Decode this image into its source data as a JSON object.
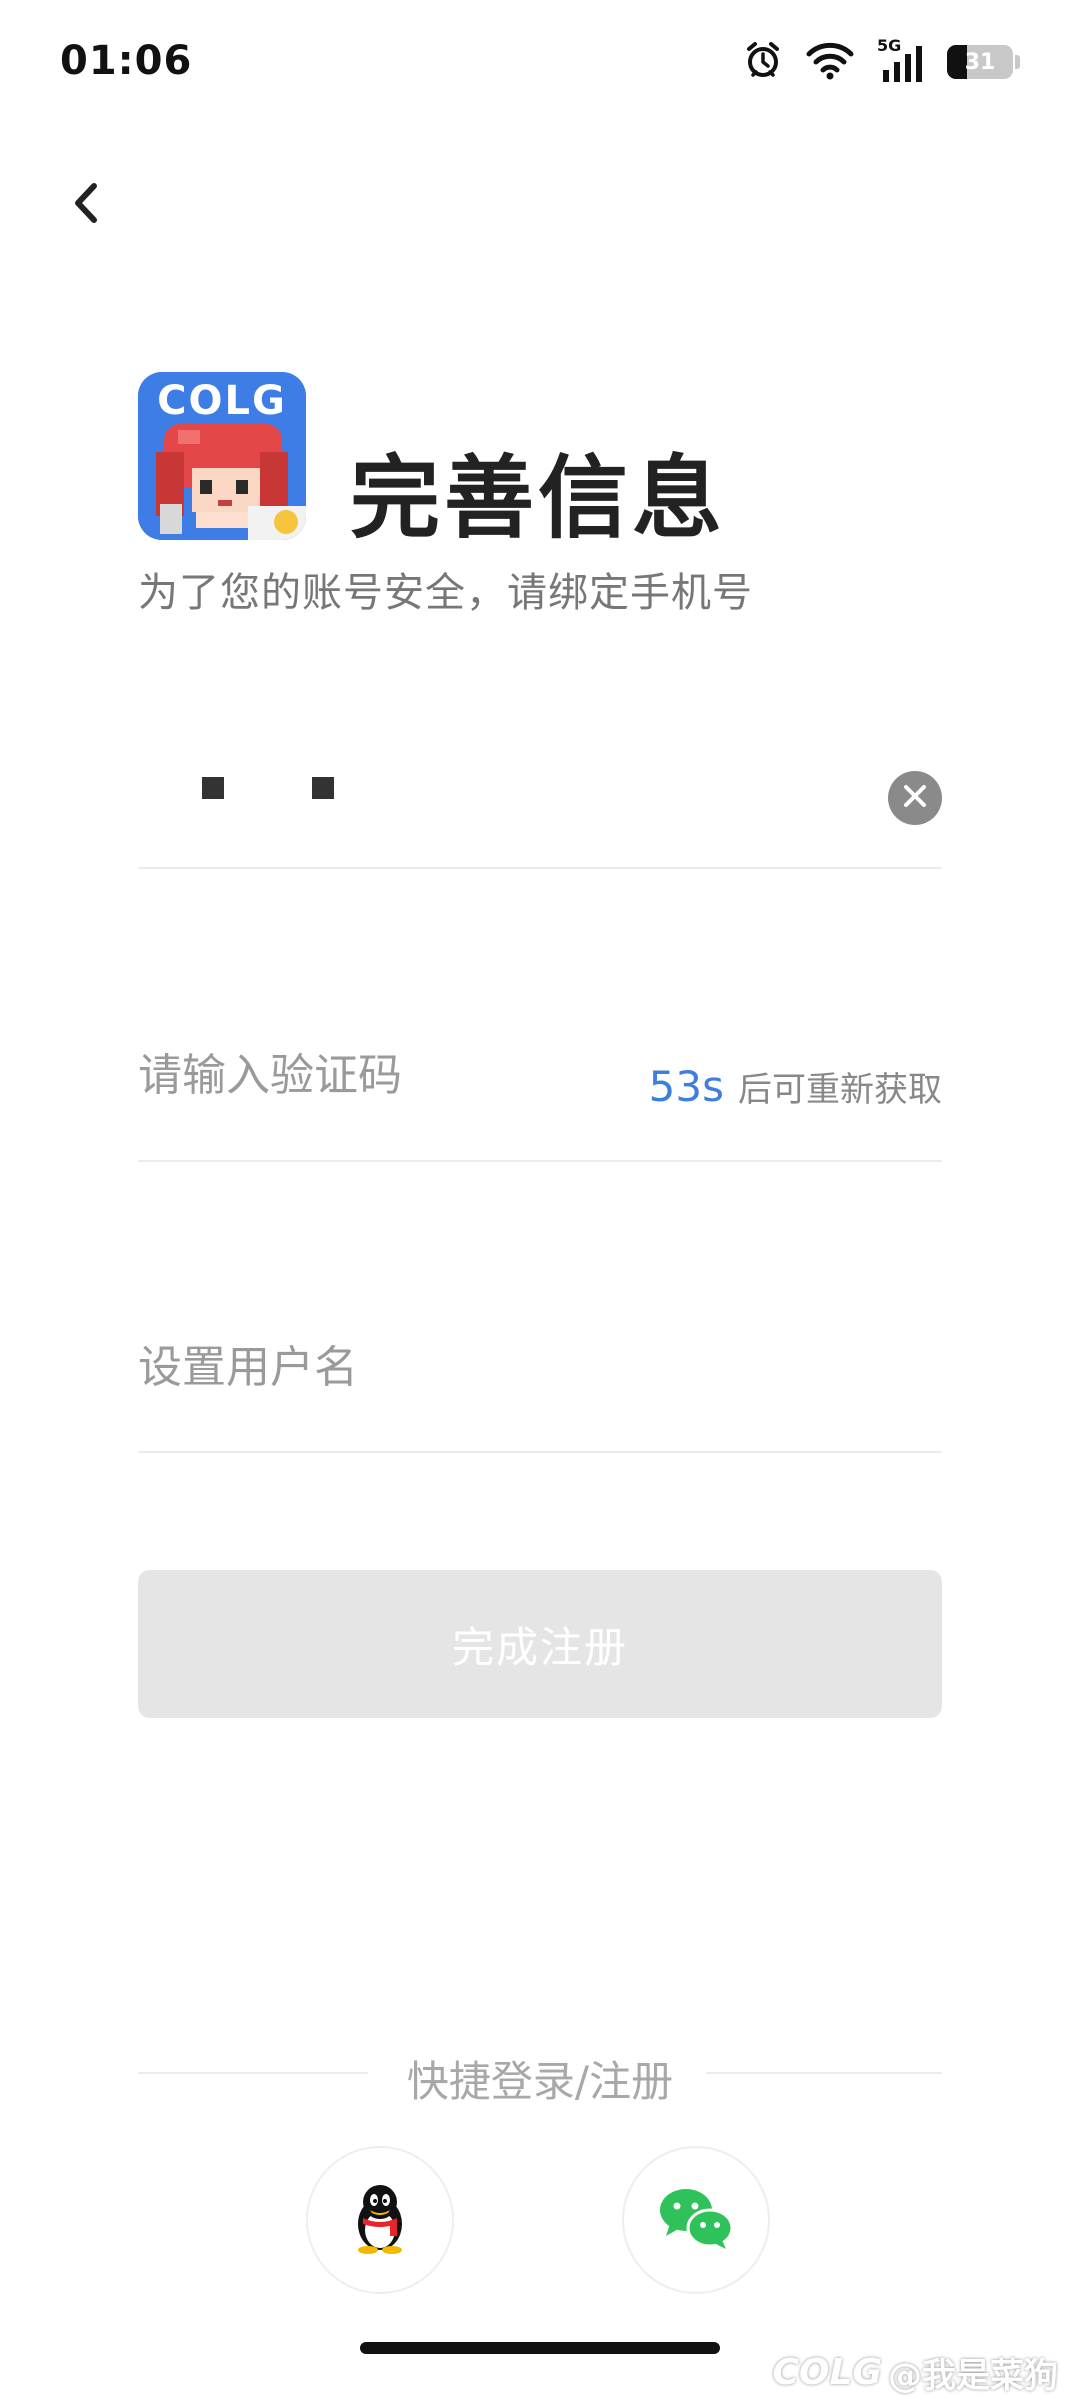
{
  "status_bar": {
    "time": "01:06",
    "network": "5G",
    "battery": "31",
    "battery_level": 0.31
  },
  "header": {
    "back_icon": "chevron-left-icon"
  },
  "app": {
    "logo_text": "COLG",
    "page_title": "完善信息",
    "subtitle": "为了您的账号安全，请绑定手机号"
  },
  "form": {
    "clear_icon": "close-icon",
    "code_placeholder": "请输入验证码",
    "countdown_seconds": "53s",
    "countdown_label": "后可重新获取",
    "username_placeholder": "设置用户名",
    "submit_label": "完成注册"
  },
  "quick_login": {
    "label": "快捷登录/注册",
    "providers": [
      "qq-icon",
      "wechat-icon"
    ]
  },
  "watermark": {
    "brand": "COLG",
    "text": "@我是菜狗"
  },
  "colors": {
    "accent": "#3d7fe0",
    "disabled_button": "#e5e5e5",
    "wechat_green": "#2fc25b",
    "logo_bg": "#3f7de6"
  }
}
